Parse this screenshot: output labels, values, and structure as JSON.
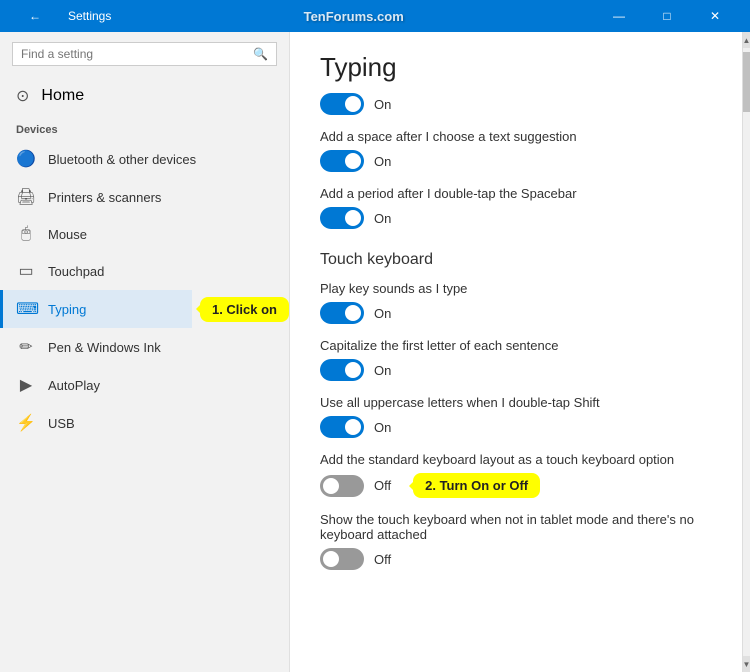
{
  "titlebar": {
    "back_label": "←",
    "title": "Settings",
    "watermark": "TenForums.com",
    "minimize": "—",
    "maximize": "□",
    "close": "✕"
  },
  "sidebar": {
    "search_placeholder": "Find a setting",
    "home_label": "Home",
    "section_label": "Devices",
    "items": [
      {
        "id": "bluetooth",
        "label": "Bluetooth & other devices",
        "icon": "⊞"
      },
      {
        "id": "printers",
        "label": "Printers & scanners",
        "icon": "🖨"
      },
      {
        "id": "mouse",
        "label": "Mouse",
        "icon": "🖱"
      },
      {
        "id": "touchpad",
        "label": "Touchpad",
        "icon": "▭"
      },
      {
        "id": "typing",
        "label": "Typing",
        "icon": "⌨",
        "active": true
      },
      {
        "id": "pen",
        "label": "Pen & Windows Ink",
        "icon": "✏"
      },
      {
        "id": "autoplay",
        "label": "AutoPlay",
        "icon": "▶"
      },
      {
        "id": "usb",
        "label": "USB",
        "icon": "⚡"
      }
    ],
    "callout1": "1. Click on"
  },
  "content": {
    "page_title": "Typing",
    "settings": [
      {
        "id": "autocorrect",
        "label": "",
        "state": "on",
        "state_label": "On"
      },
      {
        "id": "space_after",
        "label": "Add a space after I choose a text suggestion",
        "state": "on",
        "state_label": "On"
      },
      {
        "id": "period",
        "label": "Add a period after I double-tap the Spacebar",
        "state": "on",
        "state_label": "On"
      }
    ],
    "touch_keyboard_section": "Touch keyboard",
    "touch_settings": [
      {
        "id": "key_sounds",
        "label": "Play key sounds as I type",
        "state": "on",
        "state_label": "On"
      },
      {
        "id": "capitalize",
        "label": "Capitalize the first letter of each sentence",
        "state": "on",
        "state_label": "On"
      },
      {
        "id": "uppercase",
        "label": "Use all uppercase letters when I double-tap Shift",
        "state": "on",
        "state_label": "On"
      },
      {
        "id": "standard_layout",
        "label": "Add the standard keyboard layout as a touch keyboard option",
        "state": "off",
        "state_label": "Off"
      },
      {
        "id": "show_touch",
        "label": "Show the touch keyboard when not in tablet mode and there's no keyboard attached",
        "state": "off",
        "state_label": "Off"
      }
    ],
    "callout2": "2. Turn On or Off"
  }
}
